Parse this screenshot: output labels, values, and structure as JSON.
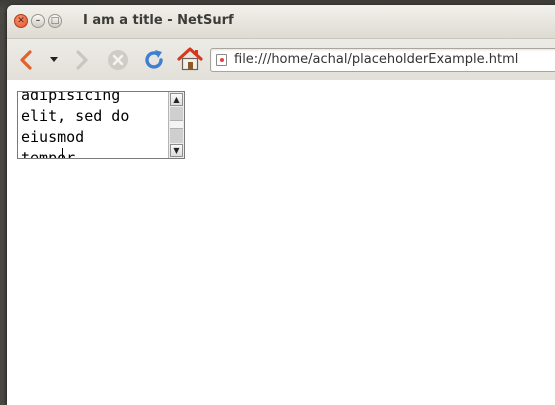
{
  "window": {
    "title": "I am a title - NetSurf"
  },
  "titlebar_buttons": {
    "close_icon": "close-icon",
    "minimize_icon": "minimize-icon",
    "maximize_icon": "maximize-icon"
  },
  "toolbar": {
    "back_icon": "back-arrow-icon",
    "history_icon": "dropdown-arrow-icon",
    "forward_icon": "forward-arrow-icon",
    "stop_icon": "stop-icon",
    "reload_icon": "reload-icon",
    "home_icon": "home-icon",
    "url": "file:///home/achal/placeholderExample.html"
  },
  "textarea": {
    "lines": "adipisicing\nelit, sed do\neiusmod\ntempor"
  },
  "colors": {
    "back_arrow": "#e0622c",
    "reload": "#3e7fcf",
    "home_roof": "#d9361e",
    "close_button": "#e0522c"
  }
}
